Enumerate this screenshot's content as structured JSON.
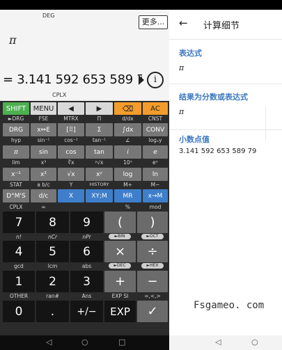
{
  "display": {
    "mode": "DEG",
    "more_button": "更多...",
    "expression": "π",
    "result": "= 3.141 592 653 589 7",
    "info_button": "i",
    "complex_label": "CPLX"
  },
  "keypad": {
    "row1": [
      "SHIFT",
      "MENU",
      "◀",
      "▶",
      "⌫",
      "AC"
    ],
    "row1_sub": [
      "►DRG",
      "FSE",
      "MTRX",
      "Π",
      "d/dx",
      "CNST"
    ],
    "row2": [
      "DRG",
      "x⇔E",
      "[⠿]",
      "Σ",
      "∫dx",
      "CONV"
    ],
    "row2_sub": [
      "hyp",
      "sin⁻¹",
      "cos⁻¹",
      "tan⁻¹",
      "∠",
      "logₓy"
    ],
    "row3": [
      "π",
      "sin",
      "cos",
      "tan",
      "i",
      "e"
    ],
    "row3_sub": [
      "lim",
      "x³",
      "∛x",
      "ʸ√x",
      "10ˣ",
      "eˣ"
    ],
    "row4": [
      "x⁻¹",
      "x²",
      "√x",
      "xʸ",
      "log",
      "ln"
    ],
    "row4_sub": [
      "STAT",
      "a b/c",
      "Y",
      "HISTORY",
      "M+",
      "M−"
    ],
    "row5": [
      "D°M'S",
      "d/c",
      "X",
      "XY;M",
      "MR",
      "x→M"
    ],
    "row5_sub": [
      "CPLX",
      "∞",
      "",
      "",
      "%",
      "mod"
    ],
    "row6": [
      "7",
      "8",
      "9",
      "(",
      ")"
    ],
    "row6_sub": [
      "n!",
      "nCr",
      "nPr",
      "►BIN",
      "►OCT"
    ],
    "row7": [
      "4",
      "5",
      "6",
      "×",
      "÷"
    ],
    "row7_sub": [
      "gcd",
      "lcm",
      "abs",
      "►DEC",
      "►HEX"
    ],
    "row8": [
      "1",
      "2",
      "3",
      "+",
      "−"
    ],
    "row8_sub": [
      "OTHER",
      "ran#",
      "Ans",
      "EXP SI",
      "=,<,>"
    ],
    "row9": [
      "0",
      ".",
      "+/−",
      "EXP",
      "✓"
    ]
  },
  "nav_left": [
    "◁",
    "○",
    "□"
  ],
  "detail": {
    "back_icon": "←",
    "title": "计算细节",
    "expression_label": "表达式",
    "expression_value": "π",
    "fraction_label": "结果为分数或表达式",
    "fraction_value": "π",
    "decimal_label": "小数点值",
    "decimal_value": "3.141 592 653 589 79",
    "watermark": "Fsgameo. com"
  },
  "nav_right": [
    "◁",
    "○"
  ],
  "colors": {
    "shift_green": "#4caf50",
    "orange": "#f39c2b",
    "blue_key": "#3f7ecb",
    "section_blue": "#3b78c0"
  }
}
